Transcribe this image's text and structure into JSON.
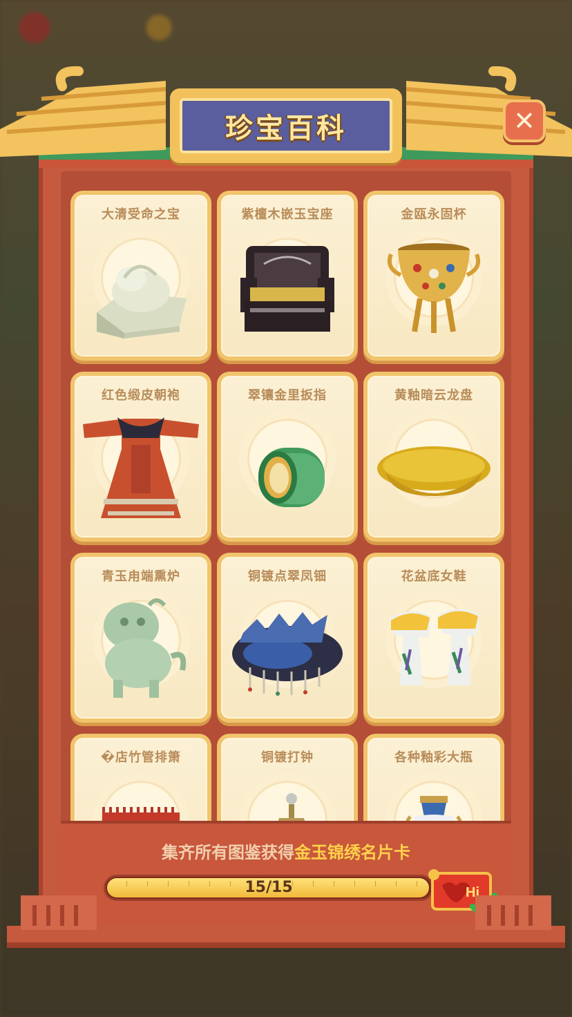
{
  "title": "珍宝百科",
  "close_icon": "close-icon",
  "cards": [
    {
      "label": "大清受命之宝",
      "icon": "jade-seal"
    },
    {
      "label": "紫檀木嵌玉宝座",
      "icon": "throne"
    },
    {
      "label": "金瓯永固杯",
      "icon": "golden-cup"
    },
    {
      "label": "红色缎皮朝袍",
      "icon": "red-robe"
    },
    {
      "label": "翠镶金里扳指",
      "icon": "jade-ring"
    },
    {
      "label": "黄釉暗云龙盘",
      "icon": "yellow-plate"
    },
    {
      "label": "青玉甪端熏炉",
      "icon": "jade-censer"
    },
    {
      "label": "铜镀点翠凤钿",
      "icon": "phoenix-headdress"
    },
    {
      "label": "花盆底女鞋",
      "icon": "shoes"
    },
    {
      "label": "�店竹管排箫",
      "icon": "panpipe"
    },
    {
      "label": "铜镀打钟",
      "icon": "clock"
    },
    {
      "label": "各种釉彩大瓶",
      "icon": "vase"
    }
  ],
  "footer": {
    "prefix": "集齐所有图鉴获得",
    "highlight": "金玉锦绣名片卡"
  },
  "progress": {
    "current": 15,
    "total": 15,
    "text": "15/15"
  },
  "reward": {
    "label": "Hi",
    "icon": "name-card-reward-icon",
    "check_icon": "checkmark-icon"
  },
  "colors": {
    "panel": "#c65a3f",
    "card": "#fbf0d4",
    "card_border": "#f1c46c",
    "title_bg": "#5a5e9e",
    "title_text": "#ffe7a0",
    "highlight": "#ffd24a"
  }
}
